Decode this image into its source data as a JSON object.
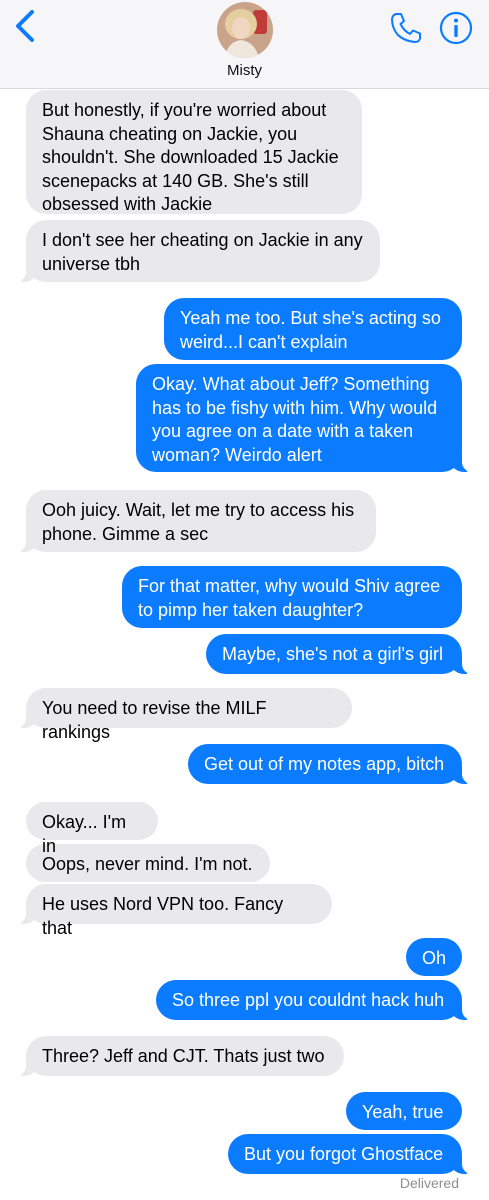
{
  "header": {
    "contact_name": "Misty",
    "icons": {
      "back": "chevron-left-icon",
      "phone": "phone-icon",
      "info": "info-icon"
    },
    "accent_color": "#0b7cff"
  },
  "messages": [
    {
      "from": "them",
      "text": "But honestly, if you're worried about Shauna cheating on Jackie, you shouldn't. She downloaded 15 Jackie scenepacks at 140 GB. She's still obsessed with Jackie"
    },
    {
      "from": "them",
      "text": "I don't see her cheating on Jackie in any universe tbh"
    },
    {
      "from": "me",
      "text": "Yeah me too. But she's acting so weird...I can't explain"
    },
    {
      "from": "me",
      "text": "Okay. What about Jeff? Something has to be fishy with him. Why would you agree on a date with a taken woman? Weirdo alert"
    },
    {
      "from": "them",
      "text": "Ooh juicy. Wait, let me try to access his phone. Gimme a sec"
    },
    {
      "from": "me",
      "text": "For that matter, why would Shiv agree to pimp her taken daughter?"
    },
    {
      "from": "me",
      "text": "Maybe, she's not a girl's girl"
    },
    {
      "from": "them",
      "text": "You need to revise the MILF rankings"
    },
    {
      "from": "me",
      "text": "Get out of my notes app, bitch"
    },
    {
      "from": "them",
      "text": "Okay... I'm in"
    },
    {
      "from": "them",
      "text": "Oops, never mind. I'm not."
    },
    {
      "from": "them",
      "text": "He uses Nord VPN too. Fancy that"
    },
    {
      "from": "me",
      "text": "Oh"
    },
    {
      "from": "me",
      "text": "So three ppl you couldnt hack huh"
    },
    {
      "from": "them",
      "text": "Three? Jeff and CJT. Thats just two"
    },
    {
      "from": "me",
      "text": "Yeah, true"
    },
    {
      "from": "me",
      "text": "But you forgot Ghostface"
    }
  ],
  "status": "Delivered",
  "colors": {
    "incoming_bubble": "#e9e9eb",
    "outgoing_bubble": "#0b7cff"
  }
}
